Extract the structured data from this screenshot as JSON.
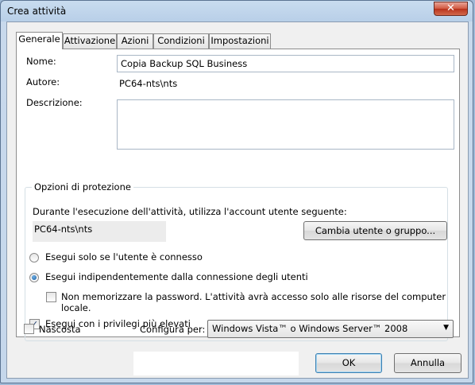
{
  "window": {
    "title": "Crea attività",
    "close_label": "✕"
  },
  "tabs": [
    {
      "label": "Generale"
    },
    {
      "label": "Attivazione"
    },
    {
      "label": "Azioni"
    },
    {
      "label": "Condizioni"
    },
    {
      "label": "Impostazioni"
    }
  ],
  "general": {
    "name_label": "Nome:",
    "name_value": "Copia Backup SQL Business",
    "author_label": "Autore:",
    "author_value": "PC64-nts\\nts",
    "description_label": "Descrizione:",
    "description_value": ""
  },
  "security": {
    "group_title": "Opzioni di protezione",
    "account_prompt": "Durante l'esecuzione dell'attività, utilizza l'account utente seguente:",
    "account_value": "PC64-nts\\nts",
    "change_user_button": "Cambia utente o gruppo...",
    "radio_logged_on": "Esegui solo se l'utente è connesso",
    "radio_always": "Esegui indipendentemente dalla connessione degli utenti",
    "selected_radio": "always",
    "no_password_label": "Non memorizzare la password. L'attività avrà accesso solo alle risorse del computer locale.",
    "no_password_checked": false,
    "highest_privileges_label": "Esegui con i privilegi più elevati",
    "highest_privileges_checked": true
  },
  "footer": {
    "hidden_label": "Nascosta",
    "hidden_checked": false,
    "configure_label": "Configura per:",
    "configure_value": "Windows Vista™ o Windows Server™ 2008",
    "ok_button": "OK",
    "cancel_button": "Annulla"
  }
}
